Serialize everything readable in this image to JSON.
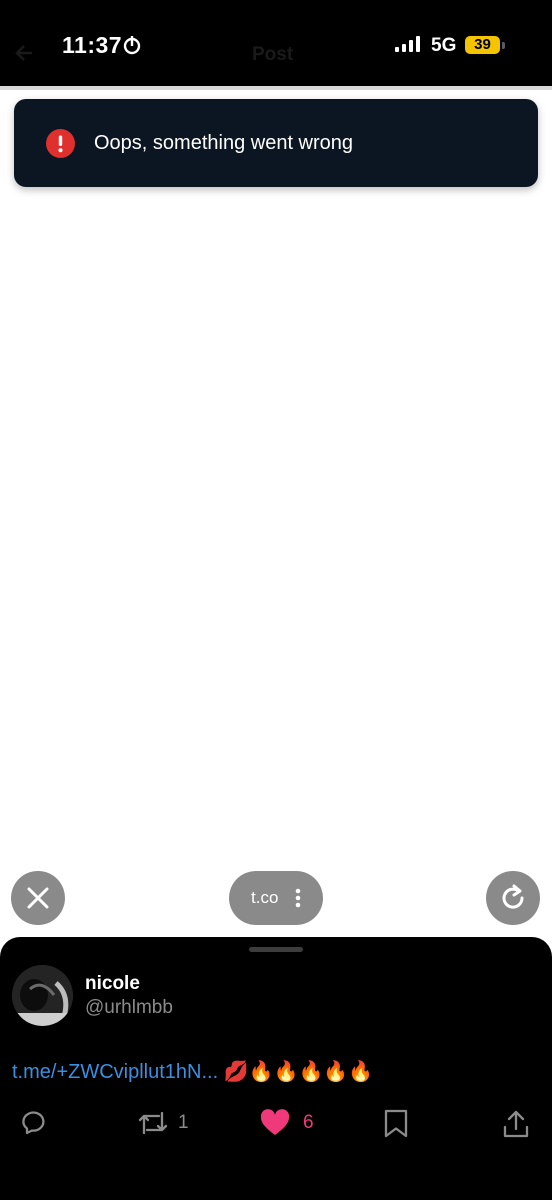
{
  "status_bar": {
    "time": "11:37",
    "network": "5G",
    "battery": "39",
    "ghost_title": "Post"
  },
  "toast": {
    "message": "Oops, something went wrong",
    "accent": "#e0302d"
  },
  "browser": {
    "url": "t.co"
  },
  "post": {
    "name": "nicole",
    "handle": "@urhlmbb",
    "link_text": "t.me/+ZWCvipllut1hN...",
    "emojis": "💋🔥🔥🔥🔥🔥",
    "reposts": "1",
    "likes": "6",
    "like_color": "#f0397b",
    "link_color": "#3b8fe0"
  },
  "icons": {
    "status": [
      "focus-icon",
      "signal-icon"
    ],
    "fabs": [
      "close-icon",
      "reload-icon",
      "more-vertical-icon"
    ],
    "actions": [
      "reply-icon",
      "repost-icon",
      "heart-icon",
      "bookmark-icon",
      "share-icon"
    ]
  }
}
